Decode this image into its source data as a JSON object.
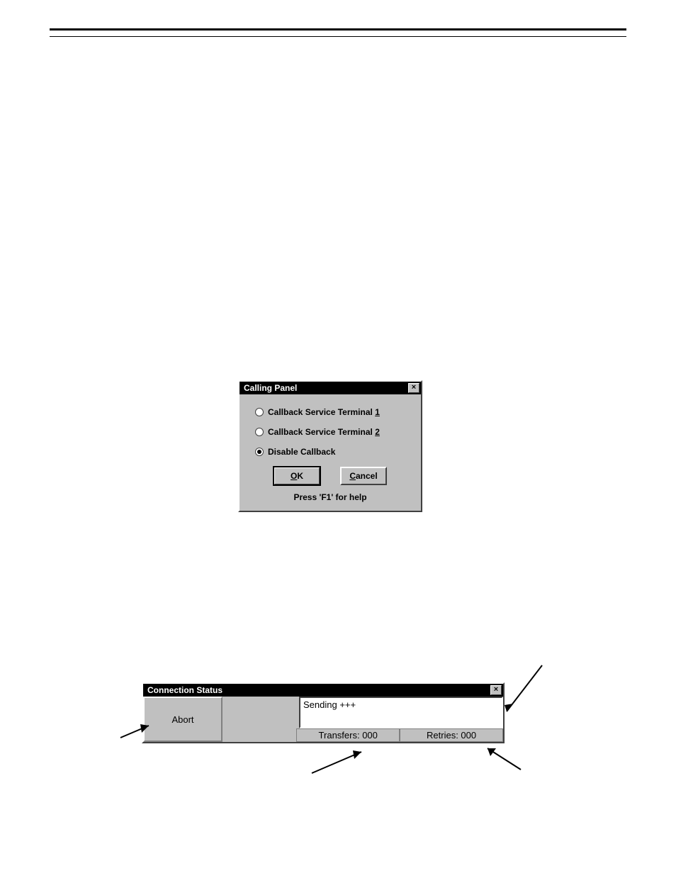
{
  "calling_panel": {
    "title": "Calling Panel",
    "options": [
      {
        "label_pre": "Callback Service Terminal ",
        "label_ul": "1",
        "checked": false
      },
      {
        "label_pre": "Callback Service Terminal ",
        "label_ul": "2",
        "checked": false
      },
      {
        "label_pre": "Disable Callback",
        "label_ul": "",
        "checked": true
      }
    ],
    "ok_ul": "O",
    "ok_rest": "K",
    "cancel_ul": "C",
    "cancel_rest": "ancel",
    "help_text": "Press 'F1' for help"
  },
  "connection_status": {
    "title": "Connection Status",
    "abort_label": "Abort",
    "message": "Sending +++",
    "transfers_label": "Transfers: 000",
    "retries_label": "Retries: 000"
  }
}
